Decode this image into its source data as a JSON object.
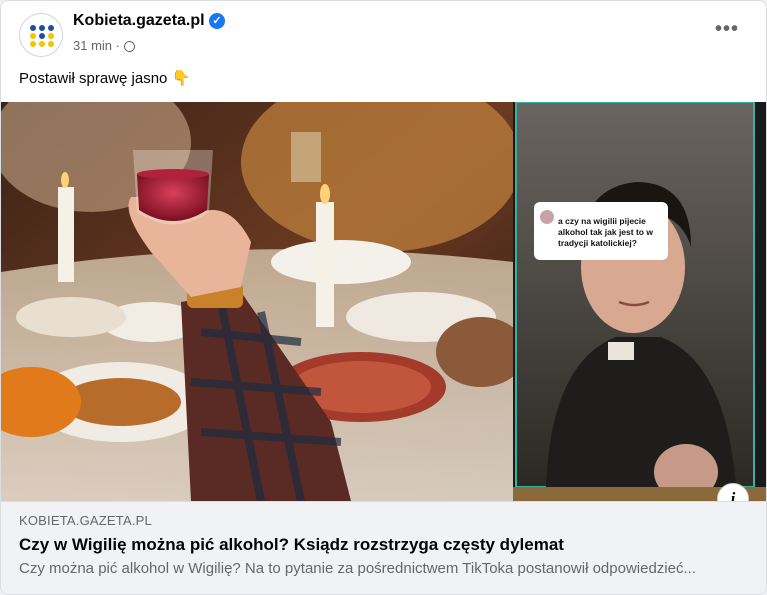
{
  "post": {
    "page_name": "Kobieta.gazeta.pl",
    "verified_glyph": "✓",
    "time": "31 min",
    "separator": "·",
    "audience_icon": "globe-icon",
    "menu_glyph": "•••",
    "text": "Postawił sprawę jasno 👇"
  },
  "video_overlay": {
    "question": "a czy na wigilii pijecie alkohol tak jak jest to w tradycji katolickiej?"
  },
  "link_preview": {
    "domain": "KOBIETA.GAZETA.PL",
    "headline": "Czy w Wigilię można pić alkohol? Ksiądz rozstrzyga częsty dylemat",
    "description": "Czy można pić alkohol w Wigilię? Na to pytanie za pośrednictwem TikToka postanowił odpowiedzieć...",
    "info_glyph": "i"
  },
  "colors": {
    "accent_blue": "#1877f2",
    "secondary_text": "#65676b",
    "avatar_blue": "#1f4e9c",
    "avatar_yellow": "#f2c500"
  }
}
